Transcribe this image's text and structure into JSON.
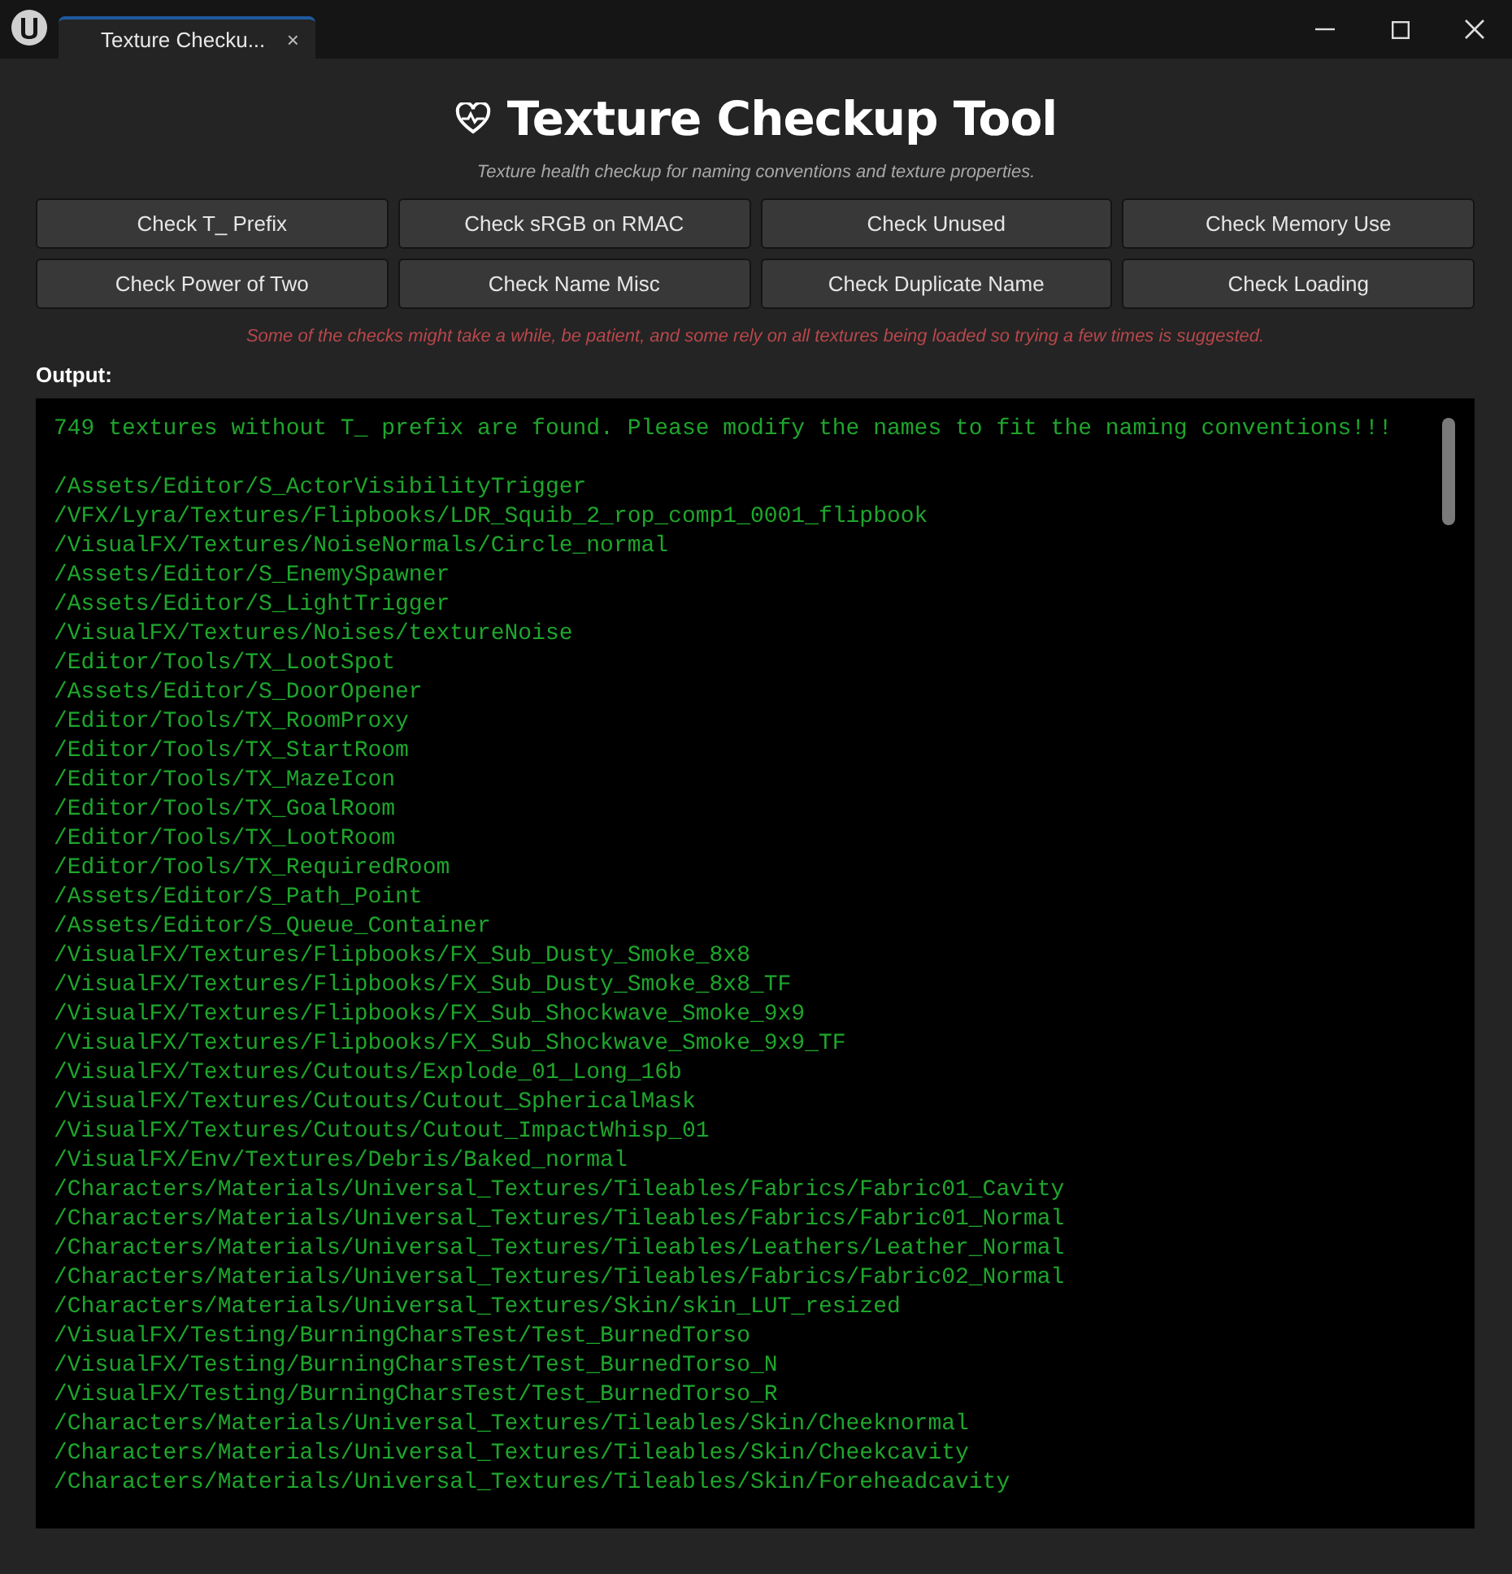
{
  "window": {
    "tab": {
      "title": "Texture Checku...",
      "close": "×",
      "selected": true
    }
  },
  "header": {
    "title": "Texture Checkup Tool",
    "subtitle": "Texture health checkup for naming conventions and texture properties."
  },
  "buttons": [
    "Check T_ Prefix",
    "Check sRGB on RMAC",
    "Check Unused",
    "Check Memory Use",
    "Check Power of Two",
    "Check Name Misc",
    "Check Duplicate Name",
    "Check Loading"
  ],
  "notice": "Some of the checks might take a while, be patient, and some rely on all textures being loaded so trying a few times is suggested.",
  "output": {
    "label": "Output:",
    "message": "749 textures without T_ prefix are found. Please modify the names to fit the naming conventions!!!",
    "lines": [
      "/Assets/Editor/S_ActorVisibilityTrigger",
      "/VFX/Lyra/Textures/Flipbooks/LDR_Squib_2_rop_comp1_0001_flipbook",
      "/VisualFX/Textures/NoiseNormals/Circle_normal",
      "/Assets/Editor/S_EnemySpawner",
      "/Assets/Editor/S_LightTrigger",
      "/VisualFX/Textures/Noises/textureNoise",
      "/Editor/Tools/TX_LootSpot",
      "/Assets/Editor/S_DoorOpener",
      "/Editor/Tools/TX_RoomProxy",
      "/Editor/Tools/TX_StartRoom",
      "/Editor/Tools/TX_MazeIcon",
      "/Editor/Tools/TX_GoalRoom",
      "/Editor/Tools/TX_LootRoom",
      "/Editor/Tools/TX_RequiredRoom",
      "/Assets/Editor/S_Path_Point",
      "/Assets/Editor/S_Queue_Container",
      "/VisualFX/Textures/Flipbooks/FX_Sub_Dusty_Smoke_8x8",
      "/VisualFX/Textures/Flipbooks/FX_Sub_Dusty_Smoke_8x8_TF",
      "/VisualFX/Textures/Flipbooks/FX_Sub_Shockwave_Smoke_9x9",
      "/VisualFX/Textures/Flipbooks/FX_Sub_Shockwave_Smoke_9x9_TF",
      "/VisualFX/Textures/Cutouts/Explode_01_Long_16b",
      "/VisualFX/Textures/Cutouts/Cutout_SphericalMask",
      "/VisualFX/Textures/Cutouts/Cutout_ImpactWhisp_01",
      "/VisualFX/Env/Textures/Debris/Baked_normal",
      "/Characters/Materials/Universal_Textures/Tileables/Fabrics/Fabric01_Cavity",
      "/Characters/Materials/Universal_Textures/Tileables/Fabrics/Fabric01_Normal",
      "/Characters/Materials/Universal_Textures/Tileables/Leathers/Leather_Normal",
      "/Characters/Materials/Universal_Textures/Tileables/Fabrics/Fabric02_Normal",
      "/Characters/Materials/Universal_Textures/Skin/skin_LUT_resized",
      "/VisualFX/Testing/BurningCharsTest/Test_BurnedTorso",
      "/VisualFX/Testing/BurningCharsTest/Test_BurnedTorso_N",
      "/VisualFX/Testing/BurningCharsTest/Test_BurnedTorso_R",
      "/Characters/Materials/Universal_Textures/Tileables/Skin/Cheeknormal",
      "/Characters/Materials/Universal_Textures/Tileables/Skin/Cheekcavity",
      "/Characters/Materials/Universal_Textures/Tileables/Skin/Foreheadcavity"
    ]
  }
}
